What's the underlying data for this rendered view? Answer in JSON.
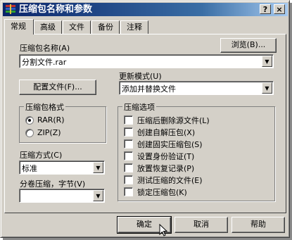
{
  "window": {
    "title": "压缩包名称和参数",
    "help_glyph": "?",
    "close_glyph": "×"
  },
  "tabs": [
    "常规",
    "高级",
    "文件",
    "备份",
    "注释"
  ],
  "archive_name": {
    "label": "压缩包名称(A)",
    "value": "分割文件.rar",
    "browse_label": "浏览(B)..."
  },
  "update_mode": {
    "label": "更新模式(U)",
    "value": "添加并替换文件"
  },
  "profiles_button": "配置文件(F)...",
  "archive_format": {
    "title": "压缩包格式",
    "options": [
      {
        "label": "RAR(R)",
        "selected": true
      },
      {
        "label": "ZIP(Z)",
        "selected": false
      }
    ]
  },
  "compression_method": {
    "label": "压缩方式(C)",
    "value": "标准"
  },
  "volume_split": {
    "label": "分卷压缩，字节(V)",
    "value": ""
  },
  "archive_options": {
    "title": "压缩选项",
    "items": [
      {
        "label": "压缩后删除源文件(L)",
        "checked": false
      },
      {
        "label": "创建自解压包(X)",
        "checked": false
      },
      {
        "label": "创建固实压缩包(S)",
        "checked": false
      },
      {
        "label": "设置身份验证(T)",
        "checked": false
      },
      {
        "label": "放置恢复记录(P)",
        "checked": false
      },
      {
        "label": "测试压缩的文件(E)",
        "checked": false
      },
      {
        "label": "锁定压缩包(K)",
        "checked": false
      }
    ]
  },
  "buttons": {
    "ok": "确定",
    "cancel": "取消",
    "help": "帮助"
  }
}
